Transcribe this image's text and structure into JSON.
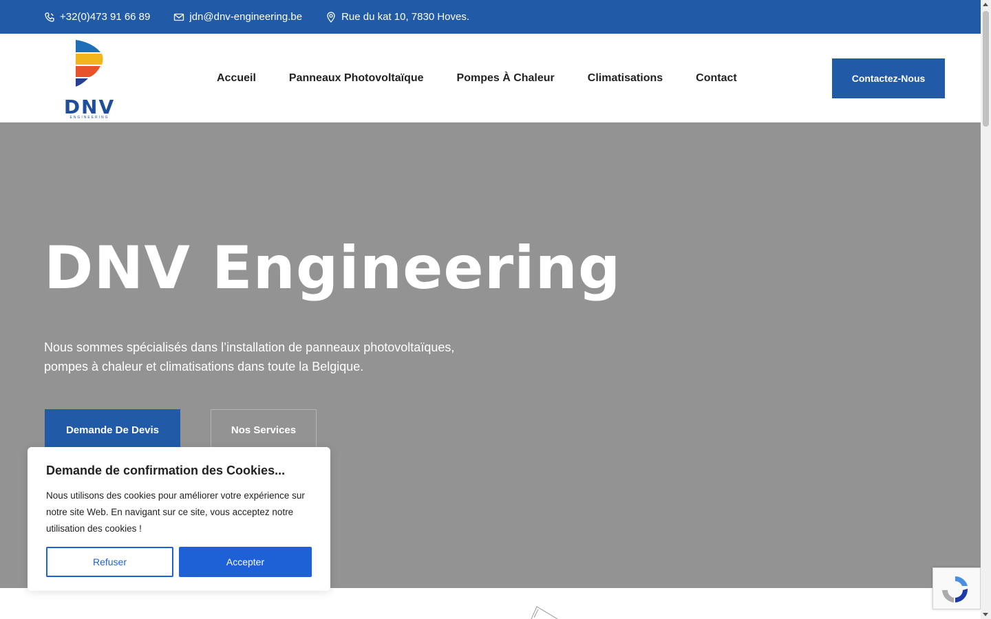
{
  "topbar": {
    "phone": "+32(0)473 91 66 89",
    "email": "jdn@dnv-engineering.be",
    "address": "Rue du kat 10, 7830 Hoves."
  },
  "header": {
    "logo_text": "DNV",
    "logo_subtext": "ENGINEERING",
    "nav": [
      "Accueil",
      "Panneaux Photovoltaïque",
      "Pompes À Chaleur",
      "Climatisations",
      "Contact"
    ],
    "cta_label": "Contactez-Nous"
  },
  "hero": {
    "title": "DNV Engineering",
    "description": "Nous sommes spécialisés dans l’installation de panneaux photovoltaïques, pompes à chaleur et climatisations dans toute la Belgique.",
    "primary_button": "Demande De Devis",
    "secondary_button": "Nos Services"
  },
  "cookie": {
    "title": "Demande de confirmation des Cookies...",
    "message": "Nous utilisons des cookies pour améliorer votre expérience sur notre site Web. En navigant sur ce site, vous acceptez notre utilisation des cookies !",
    "refuse_label": "Refuser",
    "accept_label": "Accepter"
  },
  "colors": {
    "brand_blue": "#215ba8",
    "cookie_blue": "#1e60d6",
    "hero_gray": "#939393"
  },
  "icons": {
    "phone": "phone-icon",
    "email": "mail-icon",
    "address": "map-pin-icon",
    "recaptcha": "recaptcha-icon"
  }
}
